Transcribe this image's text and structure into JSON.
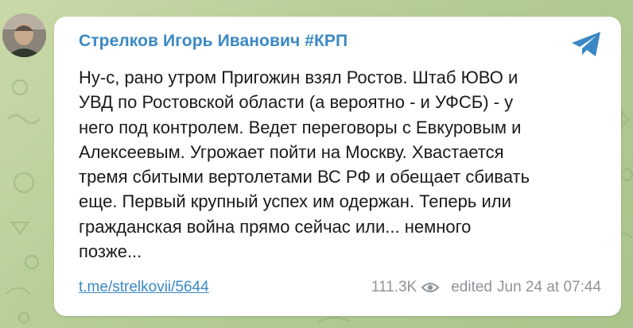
{
  "post": {
    "author": "Стрелков Игорь Иванович #КРП",
    "text": "Ну-с, рано утром Пригожин взял Ростов. Штаб ЮВО и\nУВД по Ростовской области (а вероятно - и УФСБ) - у\nнего под контролем. Ведет переговоры с Евкуровым и\nАлексеевым. Угрожает пойти на Москву. Хвастается\nтремя сбитыми вертолетами ВС РФ и обещает сбивать\nеще. Первый крупный успех им одержан. Теперь или\nгражданская война прямо сейчас или... немного\nпозже...",
    "link": "t.me/strelkovii/5644",
    "views": "111.3K",
    "edited_label": "edited",
    "date": "Jun 24 at 07:44"
  },
  "icons": {
    "telegram": "telegram-icon",
    "views": "eye-icon"
  },
  "colors": {
    "accent": "#3a88c3",
    "meta": "#8e9499",
    "background": "#b4cc95"
  }
}
